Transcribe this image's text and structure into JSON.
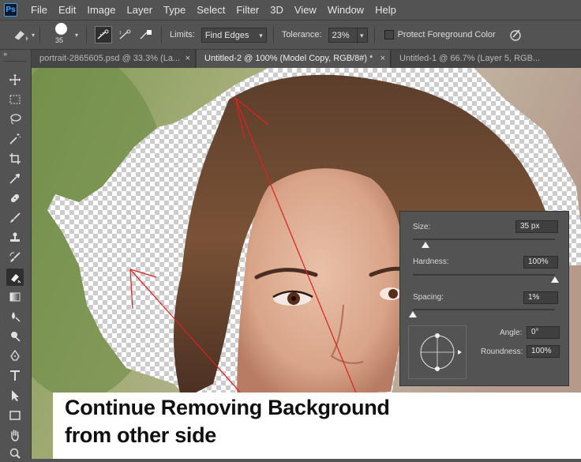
{
  "app": {
    "logo": "Ps"
  },
  "menu": [
    "File",
    "Edit",
    "Image",
    "Layer",
    "Type",
    "Select",
    "Filter",
    "3D",
    "View",
    "Window",
    "Help"
  ],
  "options": {
    "brush_size": "35",
    "limits_label": "Limits:",
    "limits_value": "Find Edges",
    "tolerance_label": "Tolerance:",
    "tolerance_value": "23%",
    "protect_label": "Protect Foreground Color",
    "panel_toggle": "»"
  },
  "tabs": [
    {
      "label": "portrait-2865605.psd @ 33.3% (La...",
      "close": "×"
    },
    {
      "label": "Untitled-2 @ 100% (Model Copy, RGB/8#) *",
      "close": "×"
    },
    {
      "label": "Untitled-1 @ 66.7% (Layer 5, RGB...",
      "close": ""
    }
  ],
  "toolbar_toggle": "»",
  "tools": [
    "move-tool",
    "marquee-tool",
    "lasso-tool",
    "magic-wand-tool",
    "crop-tool",
    "eyedropper-tool",
    "healing-brush-tool",
    "brush-tool",
    "clone-stamp-tool",
    "history-brush-tool",
    "background-eraser-tool",
    "gradient-tool",
    "blur-tool",
    "dodge-tool",
    "pen-tool",
    "type-tool",
    "path-selection-tool",
    "rectangle-tool",
    "hand-tool",
    "zoom-tool"
  ],
  "brush_panel": {
    "size_label": "Size:",
    "size_value": "35 px",
    "size_level": 0.09,
    "hardness_label": "Hardness:",
    "hardness_value": "100%",
    "hardness_level": 1.0,
    "spacing_label": "Spacing:",
    "spacing_value": "1%",
    "spacing_level": 0.0,
    "angle_label": "Angle:",
    "angle_value": "0°",
    "roundness_label": "Roundness:",
    "roundness_value": "100%"
  },
  "caption": {
    "line1": "Continue Removing Background",
    "line2": "from other side"
  },
  "colors": {
    "annotation_line": "#e02020",
    "ui_gray": "#535353",
    "caption_bg": "#ffffff"
  }
}
